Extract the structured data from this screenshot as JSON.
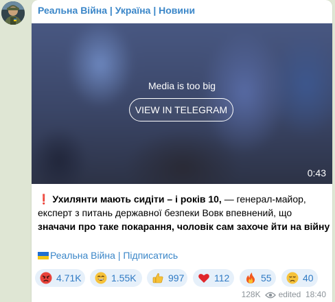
{
  "channel": {
    "name": "Реальна Війна | Україна | Новини"
  },
  "media": {
    "message": "Media is too big",
    "button_label": "VIEW IN TELEGRAM",
    "duration": "0:43"
  },
  "post": {
    "emoji": "❗",
    "line1_bold": "Ухилянти мають сидіти – і років 10,",
    "line1_rest": " — генерал-майор,",
    "line2": "експерт з питань державної безпеки Вовк впевнений, що",
    "line3_bold": "значачи про таке покарання, чоловік сам захоче йти на війну"
  },
  "subscribe": {
    "flag": "ukraine-flag-icon",
    "text": "Реальна Війна | Підписатись"
  },
  "reactions": [
    {
      "icon": "angry-face-icon",
      "count": "4.71K"
    },
    {
      "icon": "grinning-face-icon",
      "count": "1.55K"
    },
    {
      "icon": "thumbs-up-icon",
      "count": "997"
    },
    {
      "icon": "red-heart-icon",
      "count": "112"
    },
    {
      "icon": "fire-icon",
      "count": "55"
    },
    {
      "icon": "crying-face-icon",
      "count": "40"
    }
  ],
  "footer": {
    "views": "128K",
    "views_icon": "eye-icon",
    "edited_label": "edited",
    "time": "18:40"
  },
  "colors": {
    "accent": "#3a86c8",
    "reaction_bg": "#e6f0fa",
    "background": "#dfe6d4"
  }
}
